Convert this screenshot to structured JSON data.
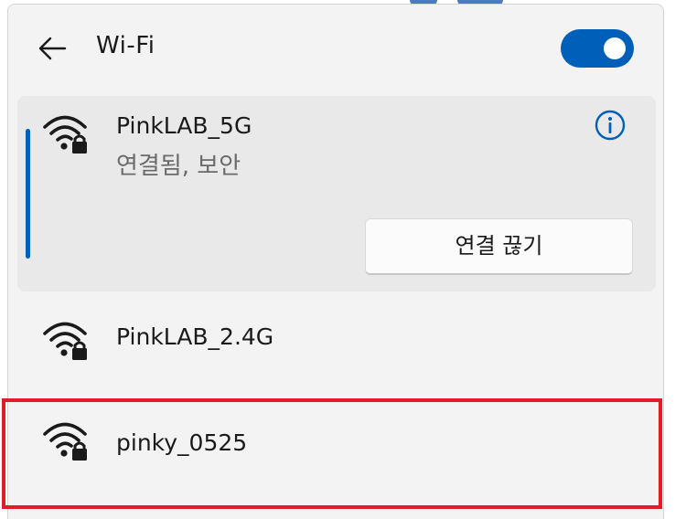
{
  "header": {
    "title": "Wi-Fi",
    "wifi_enabled": true
  },
  "networks": [
    {
      "ssid": "PinkLAB_5G",
      "status": "연결됨, 보안",
      "connected": true,
      "secured": true,
      "action_label": "연결 끊기"
    },
    {
      "ssid": "PinkLAB_2.4G",
      "connected": false,
      "secured": true
    },
    {
      "ssid": "pinky_0525",
      "connected": false,
      "secured": true,
      "highlighted": true
    }
  ],
  "colors": {
    "accent": "#005fb8",
    "highlight": "#e11c26"
  },
  "icons": {
    "back": "back-arrow-icon",
    "info": "info-icon",
    "network": "wifi-secured-icon"
  }
}
